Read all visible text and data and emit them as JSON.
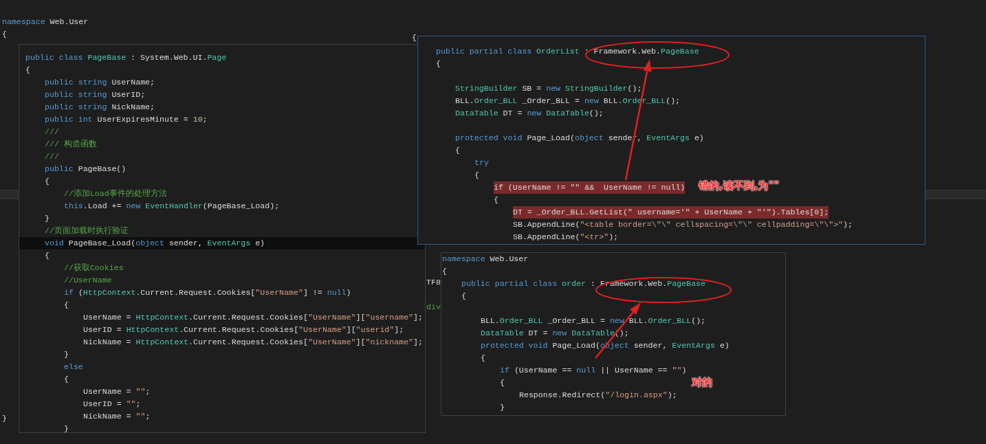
{
  "background_code": [
    {
      "tokens": [
        {
          "kind": "kw",
          "text": "namespace "
        },
        {
          "kind": "plain",
          "text": "Web.User"
        }
      ]
    },
    {
      "tokens": [
        {
          "kind": "plain",
          "text": "{"
        }
      ]
    },
    {
      "tokens": [
        {
          "kind": "plain",
          "text": "{"
        }
      ]
    },
    {
      "tokens": [
        {
          "kind": "plain",
          "text": "TF8"
        }
      ]
    },
    {
      "tokens": [
        {
          "kind": "comment",
          "text": "div"
        }
      ]
    },
    {
      "tokens": [
        {
          "kind": "plain",
          "text": "}"
        }
      ]
    }
  ],
  "panels": [
    {
      "lines": [
        {
          "kind": "code",
          "current": false,
          "tokens": [
            {
              "kind": "kw",
              "text": "public class "
            },
            {
              "kind": "type",
              "text": "PageBase"
            },
            {
              "kind": "plain",
              "text": " : System.Web.UI."
            },
            {
              "kind": "type",
              "text": "Page"
            }
          ]
        },
        {
          "kind": "code",
          "current": false,
          "tokens": [
            {
              "kind": "plain",
              "text": "{"
            }
          ],
          "children": [
            {
              "kind": "code",
              "current": false,
              "tokens": [
                {
                  "kind": "kw",
                  "text": "public string "
                },
                {
                  "kind": "plain",
                  "text": "UserName;"
                }
              ]
            },
            {
              "kind": "code",
              "current": false,
              "tokens": [
                {
                  "kind": "kw",
                  "text": "public string "
                },
                {
                  "kind": "plain",
                  "text": "UserID;"
                }
              ]
            },
            {
              "kind": "code",
              "current": false,
              "tokens": [
                {
                  "kind": "kw",
                  "text": "public string "
                },
                {
                  "kind": "plain",
                  "text": "NickName;"
                }
              ]
            },
            {
              "kind": "code",
              "current": false,
              "tokens": [
                {
                  "kind": "kw",
                  "text": "public int "
                },
                {
                  "kind": "plain",
                  "text": "UserExpiresMinute = "
                },
                {
                  "kind": "num",
                  "text": "10"
                },
                {
                  "kind": "plain",
                  "text": ";"
                }
              ]
            },
            {
              "kind": "code",
              "current": false,
              "tokens": [
                {
                  "kind": "comment",
                  "text": "///"
                }
              ]
            },
            {
              "kind": "code",
              "current": false,
              "tokens": [
                {
                  "kind": "comment",
                  "text": "/// 构造函数"
                }
              ]
            },
            {
              "kind": "code",
              "current": false,
              "tokens": [
                {
                  "kind": "comment",
                  "text": "///"
                }
              ]
            },
            {
              "kind": "code",
              "current": false,
              "tokens": [
                {
                  "kind": "kw",
                  "text": "public "
                },
                {
                  "kind": "plain",
                  "text": "PageBase()"
                }
              ]
            },
            {
              "kind": "code",
              "current": false,
              "tokens": [
                {
                  "kind": "plain",
                  "text": "{"
                }
              ],
              "children": [
                {
                  "kind": "code",
                  "current": false,
                  "tokens": [
                    {
                      "kind": "comment",
                      "text": "//添加Load事件的处理方法"
                    }
                  ]
                },
                {
                  "kind": "code",
                  "current": false,
                  "tokens": [
                    {
                      "kind": "kw",
                      "text": "this"
                    },
                    {
                      "kind": "plain",
                      "text": ".Load += "
                    },
                    {
                      "kind": "kw",
                      "text": "new "
                    },
                    {
                      "kind": "type",
                      "text": "EventHandler"
                    },
                    {
                      "kind": "plain",
                      "text": "(PageBase_Load);"
                    }
                  ]
                }
              ]
            },
            {
              "kind": "code",
              "current": false,
              "tokens": [
                {
                  "kind": "plain",
                  "text": "}"
                }
              ]
            },
            {
              "kind": "code",
              "current": false,
              "tokens": [
                {
                  "kind": "comment",
                  "text": "//页面加载时执行验证"
                }
              ]
            },
            {
              "kind": "code",
              "current": true,
              "tokens": [
                {
                  "kind": "kw",
                  "text": "void "
                },
                {
                  "kind": "plain",
                  "text": "PageBase_Load("
                },
                {
                  "kind": "kw",
                  "text": "object "
                },
                {
                  "kind": "plain",
                  "text": "sender, "
                },
                {
                  "kind": "type",
                  "text": "EventArgs"
                },
                {
                  "kind": "plain",
                  "text": " e)"
                }
              ]
            },
            {
              "kind": "code",
              "current": false,
              "tokens": [
                {
                  "kind": "plain",
                  "text": "{"
                }
              ],
              "children": [
                {
                  "kind": "code",
                  "current": false,
                  "tokens": [
                    {
                      "kind": "comment",
                      "text": "//获取Cookies"
                    }
                  ]
                },
                {
                  "kind": "code",
                  "current": false,
                  "tokens": [
                    {
                      "kind": "comment",
                      "text": "//UserName"
                    }
                  ]
                },
                {
                  "kind": "code",
                  "current": false,
                  "tokens": [
                    {
                      "kind": "kw",
                      "text": "if "
                    },
                    {
                      "kind": "plain",
                      "text": "("
                    },
                    {
                      "kind": "type",
                      "text": "HttpContext"
                    },
                    {
                      "kind": "plain",
                      "text": ".Current.Request.Cookies["
                    },
                    {
                      "kind": "str",
                      "text": "\"UserName\""
                    },
                    {
                      "kind": "plain",
                      "text": "] != "
                    },
                    {
                      "kind": "kw",
                      "text": "null"
                    },
                    {
                      "kind": "plain",
                      "text": ")"
                    }
                  ]
                },
                {
                  "kind": "code",
                  "current": false,
                  "tokens": [
                    {
                      "kind": "plain",
                      "text": "{"
                    }
                  ],
                  "children": [
                    {
                      "kind": "code",
                      "current": false,
                      "tokens": [
                        {
                          "kind": "plain",
                          "text": "UserName = "
                        },
                        {
                          "kind": "type",
                          "text": "HttpContext"
                        },
                        {
                          "kind": "plain",
                          "text": ".Current.Request.Cookies["
                        },
                        {
                          "kind": "str",
                          "text": "\"UserName\""
                        },
                        {
                          "kind": "plain",
                          "text": "]["
                        },
                        {
                          "kind": "str",
                          "text": "\"username\""
                        },
                        {
                          "kind": "plain",
                          "text": "];"
                        }
                      ]
                    },
                    {
                      "kind": "code",
                      "current": false,
                      "tokens": [
                        {
                          "kind": "plain",
                          "text": "UserID = "
                        },
                        {
                          "kind": "type",
                          "text": "HttpContext"
                        },
                        {
                          "kind": "plain",
                          "text": ".Current.Request.Cookies["
                        },
                        {
                          "kind": "str",
                          "text": "\"UserName\""
                        },
                        {
                          "kind": "plain",
                          "text": "]["
                        },
                        {
                          "kind": "str",
                          "text": "\"userid\""
                        },
                        {
                          "kind": "plain",
                          "text": "];"
                        }
                      ]
                    },
                    {
                      "kind": "code",
                      "current": false,
                      "tokens": [
                        {
                          "kind": "plain",
                          "text": "NickName = "
                        },
                        {
                          "kind": "type",
                          "text": "HttpContext"
                        },
                        {
                          "kind": "plain",
                          "text": ".Current.Request.Cookies["
                        },
                        {
                          "kind": "str",
                          "text": "\"UserName\""
                        },
                        {
                          "kind": "plain",
                          "text": "]["
                        },
                        {
                          "kind": "str",
                          "text": "\"nickname\""
                        },
                        {
                          "kind": "plain",
                          "text": "];"
                        }
                      ]
                    }
                  ]
                },
                {
                  "kind": "code",
                  "current": false,
                  "tokens": [
                    {
                      "kind": "plain",
                      "text": "}"
                    }
                  ]
                },
                {
                  "kind": "code",
                  "current": false,
                  "tokens": [
                    {
                      "kind": "kw",
                      "text": "else"
                    }
                  ]
                },
                {
                  "kind": "code",
                  "current": false,
                  "tokens": [
                    {
                      "kind": "plain",
                      "text": "{"
                    }
                  ],
                  "children": [
                    {
                      "kind": "code",
                      "current": false,
                      "tokens": [
                        {
                          "kind": "plain",
                          "text": "UserName = "
                        },
                        {
                          "kind": "str",
                          "text": "\"\""
                        },
                        {
                          "kind": "plain",
                          "text": ";"
                        }
                      ]
                    },
                    {
                      "kind": "code",
                      "current": false,
                      "tokens": [
                        {
                          "kind": "plain",
                          "text": "UserID = "
                        },
                        {
                          "kind": "str",
                          "text": "\"\""
                        },
                        {
                          "kind": "plain",
                          "text": ";"
                        }
                      ]
                    },
                    {
                      "kind": "code",
                      "current": false,
                      "tokens": [
                        {
                          "kind": "plain",
                          "text": "NickName = "
                        },
                        {
                          "kind": "str",
                          "text": "\"\""
                        },
                        {
                          "kind": "plain",
                          "text": ";"
                        }
                      ]
                    }
                  ]
                },
                {
                  "kind": "code",
                  "current": false,
                  "tokens": [
                    {
                      "kind": "plain",
                      "text": "}"
                    }
                  ]
                }
              ]
            }
          ]
        }
      ]
    },
    {
      "lines": [
        {
          "kind": "code",
          "highlighted": false,
          "tokens": [
            {
              "kind": "kw",
              "text": "public partial class "
            },
            {
              "kind": "type",
              "text": "OrderList"
            },
            {
              "kind": "plain",
              "text": " : Framework.Web."
            },
            {
              "kind": "type",
              "text": "PageBase"
            }
          ]
        },
        {
          "kind": "code",
          "highlighted": false,
          "tokens": [
            {
              "kind": "plain",
              "text": "{"
            }
          ],
          "children": [
            {
              "kind": "blank"
            },
            {
              "kind": "code",
              "highlighted": false,
              "tokens": [
                {
                  "kind": "type",
                  "text": "StringBuilder"
                },
                {
                  "kind": "plain",
                  "text": " SB = "
                },
                {
                  "kind": "kw",
                  "text": "new "
                },
                {
                  "kind": "type",
                  "text": "StringBuilder"
                },
                {
                  "kind": "plain",
                  "text": "();"
                }
              ]
            },
            {
              "kind": "code",
              "highlighted": false,
              "tokens": [
                {
                  "kind": "plain",
                  "text": "BLL."
                },
                {
                  "kind": "type",
                  "text": "Order_BLL"
                },
                {
                  "kind": "plain",
                  "text": " _Order_BLL = "
                },
                {
                  "kind": "kw",
                  "text": "new "
                },
                {
                  "kind": "plain",
                  "text": "BLL."
                },
                {
                  "kind": "type",
                  "text": "Order_BLL"
                },
                {
                  "kind": "plain",
                  "text": "();"
                }
              ]
            },
            {
              "kind": "code",
              "highlighted": false,
              "tokens": [
                {
                  "kind": "type",
                  "text": "DataTable"
                },
                {
                  "kind": "plain",
                  "text": " DT = "
                },
                {
                  "kind": "kw",
                  "text": "new "
                },
                {
                  "kind": "type",
                  "text": "DataTable"
                },
                {
                  "kind": "plain",
                  "text": "();"
                }
              ]
            },
            {
              "kind": "blank"
            },
            {
              "kind": "code",
              "highlighted": false,
              "tokens": [
                {
                  "kind": "kw",
                  "text": "protected void "
                },
                {
                  "kind": "plain",
                  "text": "Page_Load("
                },
                {
                  "kind": "kw",
                  "text": "object "
                },
                {
                  "kind": "plain",
                  "text": "sender, "
                },
                {
                  "kind": "type",
                  "text": "EventArgs"
                },
                {
                  "kind": "plain",
                  "text": " e)"
                }
              ]
            },
            {
              "kind": "code",
              "highlighted": false,
              "tokens": [
                {
                  "kind": "plain",
                  "text": "{"
                }
              ],
              "children": [
                {
                  "kind": "code",
                  "highlighted": false,
                  "tokens": [
                    {
                      "kind": "kw",
                      "text": "try"
                    }
                  ]
                },
                {
                  "kind": "code",
                  "highlighted": false,
                  "tokens": [
                    {
                      "kind": "plain",
                      "text": "{"
                    }
                  ],
                  "children": [
                    {
                      "kind": "code",
                      "highlighted": true,
                      "tokens": [
                        {
                          "kind": "plain",
                          "text": "if (UserName != \"\" &&  UserName != null)"
                        }
                      ]
                    },
                    {
                      "kind": "code",
                      "highlighted": false,
                      "tokens": [
                        {
                          "kind": "plain",
                          "text": "{"
                        }
                      ],
                      "children": [
                        {
                          "kind": "code",
                          "highlighted": true,
                          "tokens": [
                            {
                              "kind": "plain",
                              "text": "DT = _Order_BLL.GetList(\" username='\" + UserName + \"'\").Tables[0];"
                            }
                          ]
                        },
                        {
                          "kind": "code",
                          "highlighted": false,
                          "tokens": [
                            {
                              "kind": "plain",
                              "text": "SB.AppendLine("
                            },
                            {
                              "kind": "str",
                              "text": "\"<table border=\\\"\\\" cellspacing=\\\"\\\" cellpadding=\\\"\\\">\""
                            },
                            {
                              "kind": "plain",
                              "text": ");"
                            }
                          ]
                        },
                        {
                          "kind": "code",
                          "highlighted": false,
                          "tokens": [
                            {
                              "kind": "plain",
                              "text": "SB.AppendLine("
                            },
                            {
                              "kind": "str",
                              "text": "\"<tr>\""
                            },
                            {
                              "kind": "plain",
                              "text": ");"
                            }
                          ]
                        }
                      ]
                    }
                  ]
                }
              ]
            }
          ]
        }
      ]
    },
    {
      "lines": [
        {
          "kind": "code",
          "tokens": [
            {
              "kind": "kw",
              "text": "namespace "
            },
            {
              "kind": "plain",
              "text": "Web.User"
            }
          ]
        },
        {
          "kind": "code",
          "tokens": [
            {
              "kind": "plain",
              "text": "{"
            }
          ],
          "children": [
            {
              "kind": "code",
              "tokens": [
                {
                  "kind": "kw",
                  "text": "public partial class "
                },
                {
                  "kind": "type",
                  "text": "order"
                },
                {
                  "kind": "plain",
                  "text": " : Framework.Web."
                },
                {
                  "kind": "type",
                  "text": "PageBase"
                }
              ]
            },
            {
              "kind": "code",
              "tokens": [
                {
                  "kind": "plain",
                  "text": "{"
                }
              ],
              "children": [
                {
                  "kind": "blank"
                },
                {
                  "kind": "code",
                  "tokens": [
                    {
                      "kind": "plain",
                      "text": "BLL."
                    },
                    {
                      "kind": "type",
                      "text": "Order_BLL"
                    },
                    {
                      "kind": "plain",
                      "text": " _Order_BLL = "
                    },
                    {
                      "kind": "kw",
                      "text": "new "
                    },
                    {
                      "kind": "plain",
                      "text": "BLL."
                    },
                    {
                      "kind": "type",
                      "text": "Order_BLL"
                    },
                    {
                      "kind": "plain",
                      "text": "();"
                    }
                  ]
                },
                {
                  "kind": "code",
                  "tokens": [
                    {
                      "kind": "type",
                      "text": "DataTable"
                    },
                    {
                      "kind": "plain",
                      "text": " DT = "
                    },
                    {
                      "kind": "kw",
                      "text": "new "
                    },
                    {
                      "kind": "type",
                      "text": "DataTable"
                    },
                    {
                      "kind": "plain",
                      "text": "();"
                    }
                  ]
                },
                {
                  "kind": "code",
                  "tokens": [
                    {
                      "kind": "kw",
                      "text": "protected void "
                    },
                    {
                      "kind": "plain",
                      "text": "Page_Load("
                    },
                    {
                      "kind": "kw",
                      "text": "object "
                    },
                    {
                      "kind": "plain",
                      "text": "sender, "
                    },
                    {
                      "kind": "type",
                      "text": "EventArgs"
                    },
                    {
                      "kind": "plain",
                      "text": " e)"
                    }
                  ]
                },
                {
                  "kind": "code",
                  "tokens": [
                    {
                      "kind": "plain",
                      "text": "{"
                    }
                  ],
                  "children": [
                    {
                      "kind": "code",
                      "tokens": [
                        {
                          "kind": "kw",
                          "text": "if "
                        },
                        {
                          "kind": "plain",
                          "text": "(UserName == "
                        },
                        {
                          "kind": "kw",
                          "text": "null"
                        },
                        {
                          "kind": "plain",
                          "text": " || UserName == "
                        },
                        {
                          "kind": "str",
                          "text": "\"\""
                        },
                        {
                          "kind": "plain",
                          "text": ")"
                        }
                      ]
                    },
                    {
                      "kind": "code",
                      "tokens": [
                        {
                          "kind": "plain",
                          "text": "{"
                        }
                      ],
                      "children": [
                        {
                          "kind": "code",
                          "tokens": [
                            {
                              "kind": "plain",
                              "text": "Response.Redirect("
                            },
                            {
                              "kind": "str",
                              "text": "\"/login.aspx\""
                            },
                            {
                              "kind": "plain",
                              "text": ");"
                            }
                          ]
                        }
                      ]
                    },
                    {
                      "kind": "code",
                      "tokens": [
                        {
                          "kind": "plain",
                          "text": "}"
                        }
                      ]
                    }
                  ]
                }
              ]
            }
          ]
        }
      ]
    }
  ],
  "annotations": [
    {
      "text": "错的,读不到,为\"\""
    },
    {
      "text": "对的"
    }
  ]
}
